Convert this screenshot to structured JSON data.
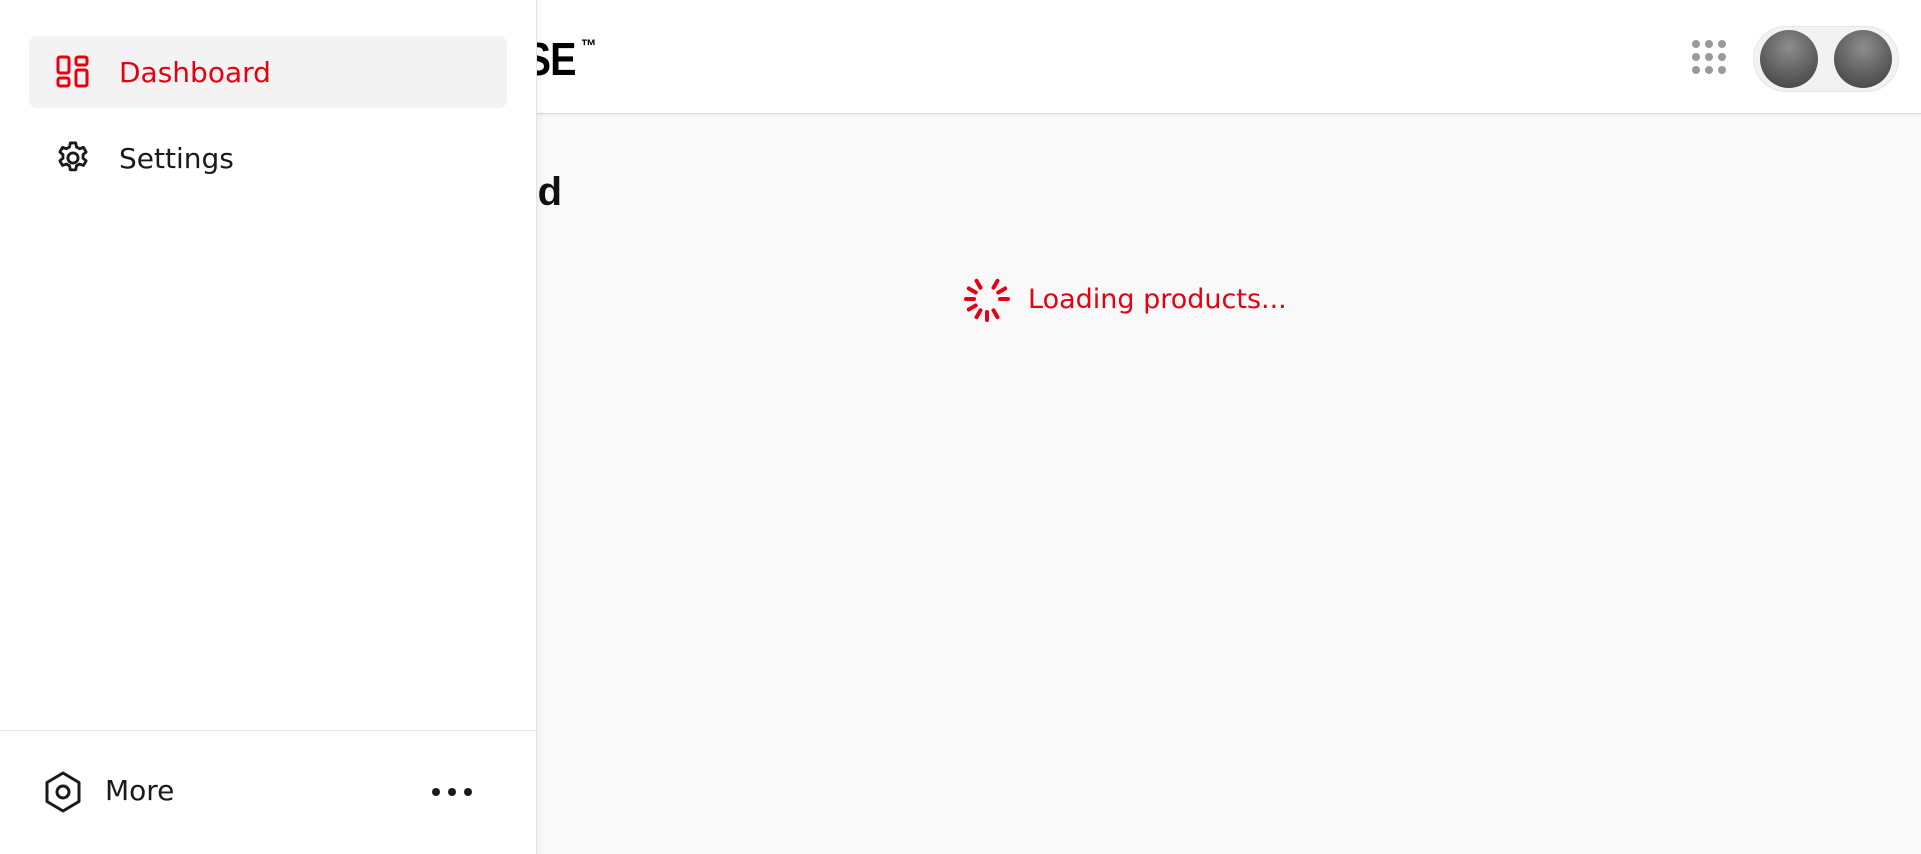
{
  "header": {
    "brand_visible": "PERWISE",
    "brand_mark": "™",
    "apps_icon": "apps-grid-icon",
    "avatars": [
      "avatar",
      "avatar"
    ]
  },
  "main": {
    "title_visible": "d",
    "loading_text": "Loading products..."
  },
  "drawer": {
    "items": [
      {
        "label": "Dashboard",
        "icon": "dashboard-icon",
        "active": true
      },
      {
        "label": "Settings",
        "icon": "gear-icon",
        "active": false
      }
    ],
    "footer": {
      "label": "More",
      "icon": "hexagon-nut-icon",
      "menu_icon": "ellipsis-icon"
    }
  },
  "colors": {
    "accent": "#e60012",
    "drawer_bg": "#ffffff",
    "page_bg": "#f9f9f9",
    "active_item_bg": "#f3f3f3"
  }
}
